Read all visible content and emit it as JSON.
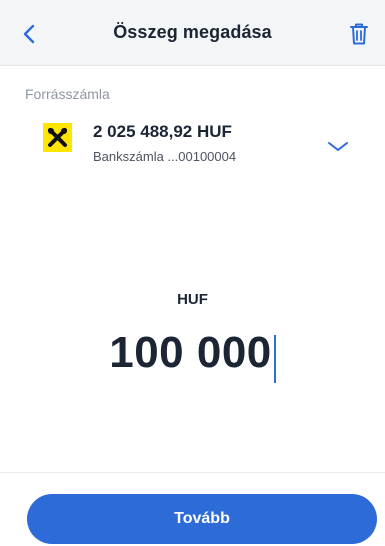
{
  "header": {
    "title": "Összeg megadása",
    "back_icon": "chevron-left-icon",
    "delete_icon": "trash-icon"
  },
  "source_account": {
    "section_label": "Forrásszámla",
    "balance": "2 025 488,92 HUF",
    "account_name": "Bankszámla ...00100004",
    "logo_icon": "bank-logo-icon",
    "expand_icon": "chevron-down-icon"
  },
  "amount": {
    "currency": "HUF",
    "value": "100 000"
  },
  "actions": {
    "next_label": "Tovább"
  },
  "colors": {
    "accent": "#2d6bd8",
    "logo_yellow": "#ffe600",
    "text": "#1b2533",
    "muted": "#9097a3"
  }
}
